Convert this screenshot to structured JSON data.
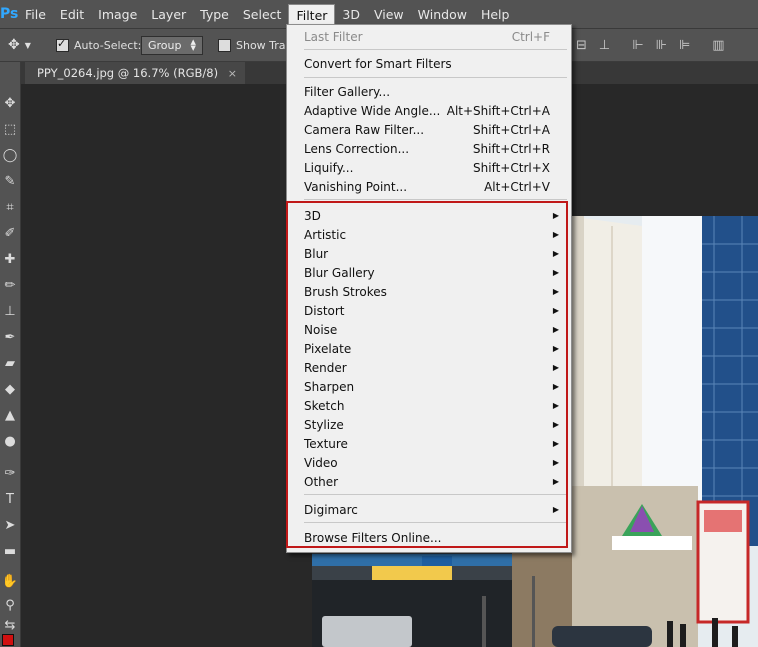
{
  "menubar": {
    "logo": "Ps",
    "items": [
      "File",
      "Edit",
      "Image",
      "Layer",
      "Type",
      "Select",
      "Filter",
      "3D",
      "View",
      "Window",
      "Help"
    ],
    "active": "Filter"
  },
  "options": {
    "auto_select_label": "Auto-Select:",
    "auto_select_value": "Group",
    "show_transform_label": "Show Tran"
  },
  "document": {
    "tab_title": "PPY_0264.jpg @ 16.7% (RGB/8)",
    "close_glyph": "×"
  },
  "filter_menu": {
    "last_filter": {
      "label": "Last Filter",
      "shortcut": "Ctrl+F"
    },
    "smart": {
      "label": "Convert for Smart Filters"
    },
    "group1": [
      {
        "label": "Filter Gallery...",
        "shortcut": ""
      },
      {
        "label": "Adaptive Wide Angle...",
        "shortcut": "Alt+Shift+Ctrl+A"
      },
      {
        "label": "Camera Raw Filter...",
        "shortcut": "Shift+Ctrl+A"
      },
      {
        "label": "Lens Correction...",
        "shortcut": "Shift+Ctrl+R"
      },
      {
        "label": "Liquify...",
        "shortcut": "Shift+Ctrl+X"
      },
      {
        "label": "Vanishing Point...",
        "shortcut": "Alt+Ctrl+V"
      }
    ],
    "submenus": [
      "3D",
      "Artistic",
      "Blur",
      "Blur Gallery",
      "Brush Strokes",
      "Distort",
      "Noise",
      "Pixelate",
      "Render",
      "Sharpen",
      "Sketch",
      "Stylize",
      "Texture",
      "Video",
      "Other"
    ],
    "digimarc": "Digimarc",
    "browse": "Browse Filters Online..."
  },
  "colors": {
    "highlight_border": "#c01818",
    "menu_bg": "#f0f0f0",
    "ui_panel": "#535353"
  }
}
